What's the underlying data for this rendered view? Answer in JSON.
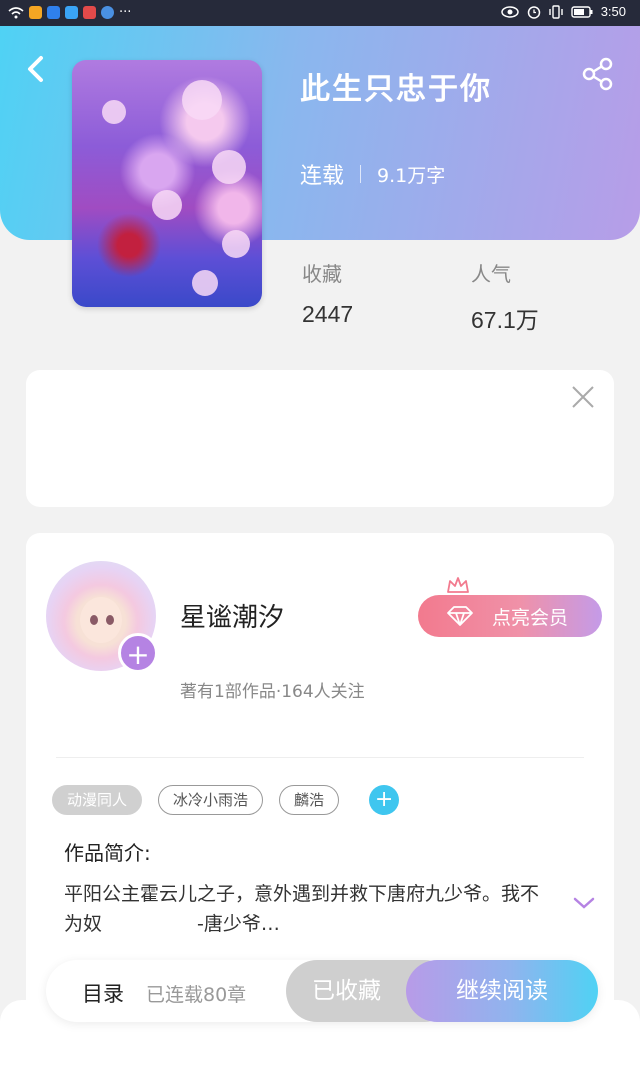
{
  "status_bar": {
    "time": "3:50",
    "more": "···"
  },
  "book": {
    "title": "此生只忠于你",
    "status": "连载",
    "word_count": "9.1万字",
    "favorites_label": "收藏",
    "favorites_value": "2447",
    "popularity_label": "人气",
    "popularity_value": "67.1万"
  },
  "author": {
    "name": "星谧潮汐",
    "info": "著有1部作品·164人关注",
    "follow_symbol": "+",
    "vip_button": "点亮会员"
  },
  "tags": [
    "动漫同人",
    "冰冷小雨浩",
    "麟浩"
  ],
  "tag_add_symbol": "+",
  "intro": {
    "heading": "作品简介:",
    "text": "平阳公主霍云儿之子，意外遇到并救下唐府九少爷。我不为奴　　　　　-唐少爷…"
  },
  "bottom_bar": {
    "toc": "目录",
    "chapters": "已连载80章",
    "favorited": "已收藏",
    "continue": "继续阅读"
  },
  "colors": {
    "header_start": "#4fd2f4",
    "header_end": "#b79de8",
    "accent_purple": "#b583e3",
    "vip_pink": "#f27a8e",
    "tag_add_blue": "#3fc6ef"
  }
}
